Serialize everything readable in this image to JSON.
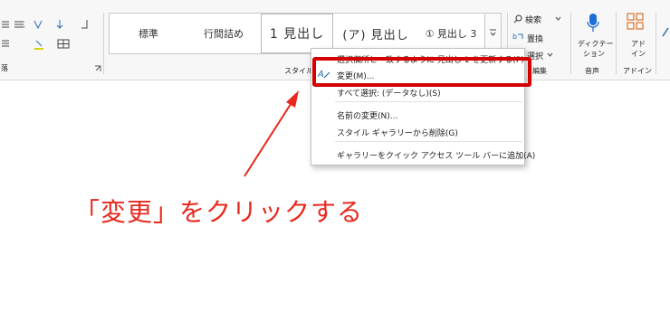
{
  "ribbon": {
    "paragraph_group_label": "落",
    "styles_group_label_partial": "スタイル",
    "editing_group_label": "編集",
    "voice_group_label": "音声",
    "addin_group_label": "アドイン",
    "styles": [
      {
        "label": "標準"
      },
      {
        "label": "行間詰め"
      },
      {
        "label": "1 見出し"
      },
      {
        "label": "(ア) 見出し"
      },
      {
        "label": "① 見出し 3"
      }
    ],
    "editing": {
      "search": "検索",
      "replace": "置換",
      "select": "選択"
    },
    "dictate": {
      "line1": "ディクテー",
      "line2": "ション"
    },
    "addin": {
      "line1": "アド",
      "line2": "イン"
    }
  },
  "context_menu": {
    "items": [
      {
        "label": "選択個所と一致するように 見出し 1 を更新する(P)"
      },
      {
        "label": "変更(M)..."
      },
      {
        "label": "すべて選択: (データなし)(S)"
      },
      {
        "label": "名前の変更(N)..."
      },
      {
        "label": "スタイル ギャラリーから削除(G)"
      },
      {
        "label": "ギャラリーをクイック アクセス ツール バーに追加(A)"
      }
    ]
  },
  "annotation": {
    "text": "「変更」をクリックする",
    "color": "#e8281e"
  },
  "colors": {
    "highlight": "#d40000",
    "ribbon_bg": "#f7f7f7",
    "icon_blue": "#2b6cb0",
    "icon_orange": "#d35400"
  }
}
